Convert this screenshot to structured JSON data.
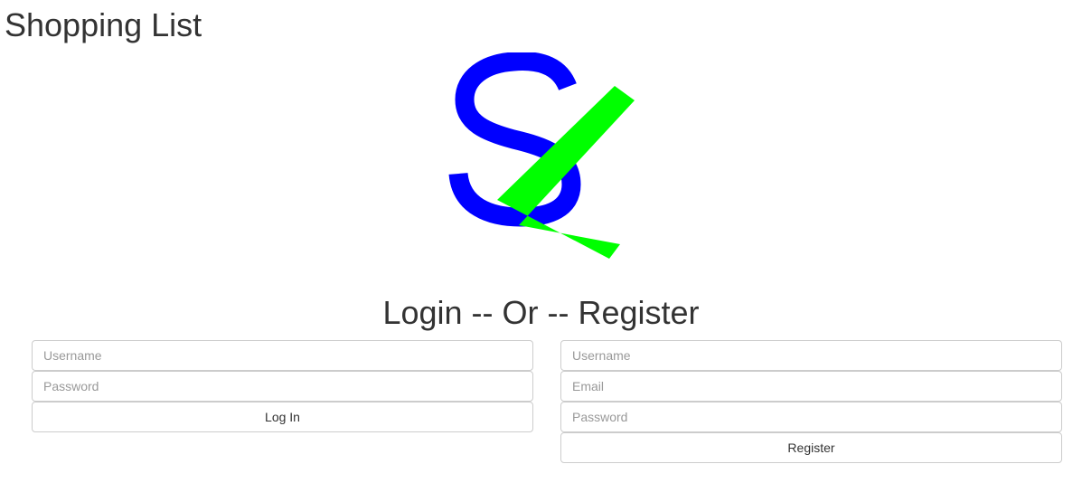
{
  "app": {
    "title": "Shopping List"
  },
  "logo": {
    "name": "SL",
    "colors": {
      "s_color": "#0000FF",
      "l_color": "#00FF00"
    }
  },
  "auth": {
    "heading": "Login -- Or -- Register",
    "login": {
      "username_placeholder": "Username",
      "password_placeholder": "Password",
      "submit_label": "Log In"
    },
    "register": {
      "username_placeholder": "Username",
      "email_placeholder": "Email",
      "password_placeholder": "Password",
      "submit_label": "Register"
    }
  }
}
